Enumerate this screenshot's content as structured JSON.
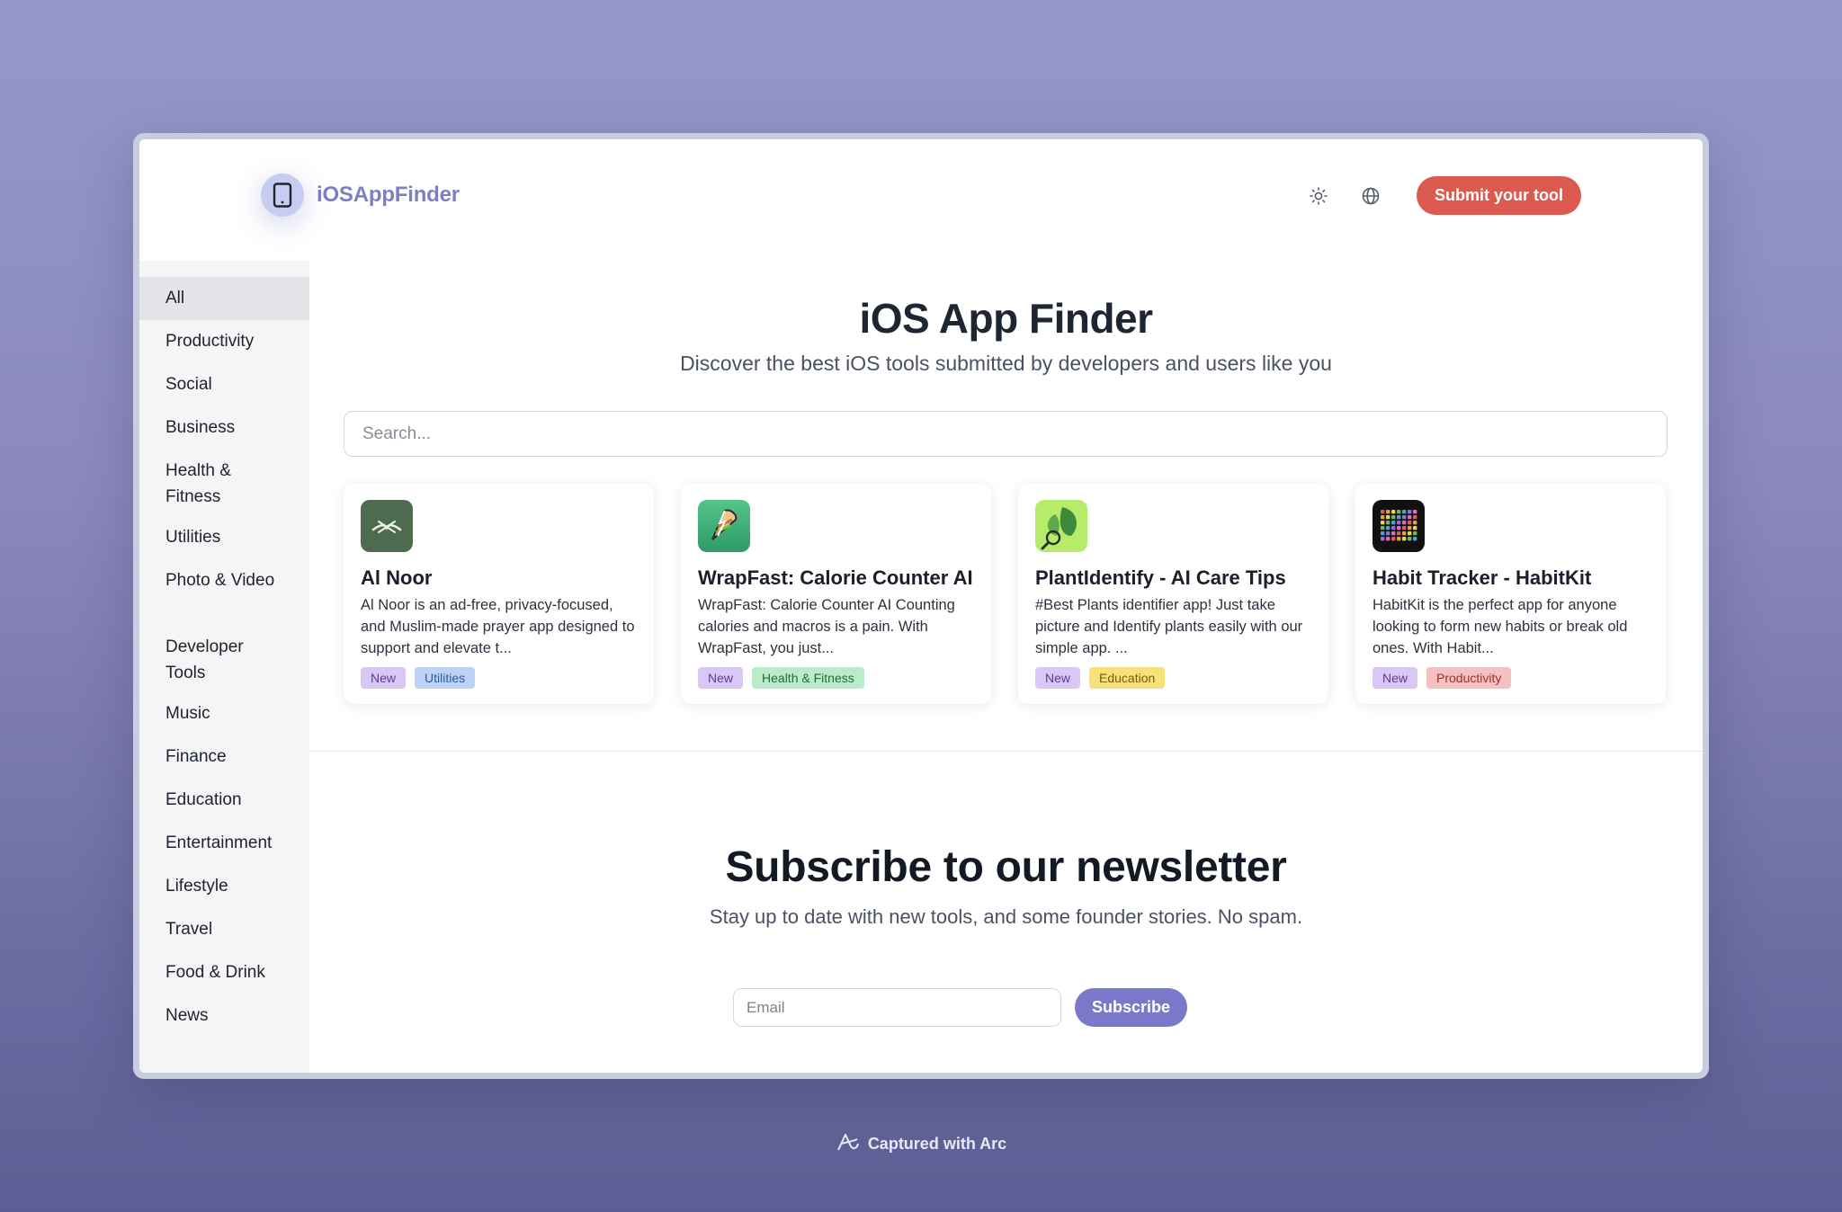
{
  "header": {
    "logo_text": "iOSAppFinder",
    "theme_icon": "sun-icon",
    "language_icon": "globe-icon",
    "submit_label": "Submit your tool"
  },
  "sidebar": {
    "items": [
      {
        "label": "All",
        "active": true
      },
      {
        "label": "Productivity"
      },
      {
        "label": "Social"
      },
      {
        "label": "Business"
      },
      {
        "label": "Health & Fitness"
      },
      {
        "label": "Utilities"
      },
      {
        "label": "Photo & Video"
      },
      {
        "label": "Developer Tools"
      },
      {
        "label": "Music"
      },
      {
        "label": "Finance"
      },
      {
        "label": "Education"
      },
      {
        "label": "Entertainment"
      },
      {
        "label": "Lifestyle"
      },
      {
        "label": "Travel"
      },
      {
        "label": "Food & Drink"
      },
      {
        "label": "News"
      }
    ]
  },
  "main": {
    "title": "iOS App Finder",
    "subtitle": "Discover the best iOS tools submitted by developers and users like you",
    "search_placeholder": "Search...",
    "cards": [
      {
        "name": "Al Noor",
        "description": "Al Noor is an ad-free, privacy-focused, and Muslim-made prayer app designed to support and elevate t...",
        "tags": [
          {
            "label": "New",
            "bg": "#d9c8f5",
            "fg": "#5b3b94"
          },
          {
            "label": "Utilities",
            "bg": "#bcd3f7",
            "fg": "#2f5a9a"
          }
        ],
        "icon": "book-icon",
        "icon_bg": "#4e6b4f"
      },
      {
        "name": "WrapFast: Calorie Counter AI",
        "description": "WrapFast: Calorie Counter AI Counting calories and macros is a pain. With WrapFast, you just...",
        "tags": [
          {
            "label": "New",
            "bg": "#d9c8f5",
            "fg": "#5b3b94"
          },
          {
            "label": "Health & Fitness",
            "bg": "#b9ecc7",
            "fg": "#256b3c"
          }
        ],
        "icon": "burrito-icon",
        "icon_bg": "#3fae7a"
      },
      {
        "name": "PlantIdentify - AI Care Tips",
        "description": "#Best Plants identifier app! Just take picture and Identify plants easily with our simple app. ...",
        "tags": [
          {
            "label": "New",
            "bg": "#d9c8f5",
            "fg": "#5b3b94"
          },
          {
            "label": "Education",
            "bg": "#f7e27a",
            "fg": "#7a5c05"
          }
        ],
        "icon": "leaf-icon",
        "icon_bg": "#b7ec6a"
      },
      {
        "name": "Habit Tracker - HabitKit",
        "description": "HabitKit is the perfect app for anyone looking to form new habits or break old ones. With Habit...",
        "tags": [
          {
            "label": "New",
            "bg": "#d9c8f5",
            "fg": "#5b3b94"
          },
          {
            "label": "Productivity",
            "bg": "#f5c0c0",
            "fg": "#9a3030"
          }
        ],
        "icon": "grid-icon",
        "icon_bg": "#111111"
      }
    ]
  },
  "newsletter": {
    "title": "Subscribe to our newsletter",
    "subtitle": "Stay up to date with new tools, and some founder stories. No spam.",
    "email_placeholder": "Email",
    "subscribe_label": "Subscribe"
  },
  "footer": {
    "captured_label": "Captured with Arc"
  }
}
